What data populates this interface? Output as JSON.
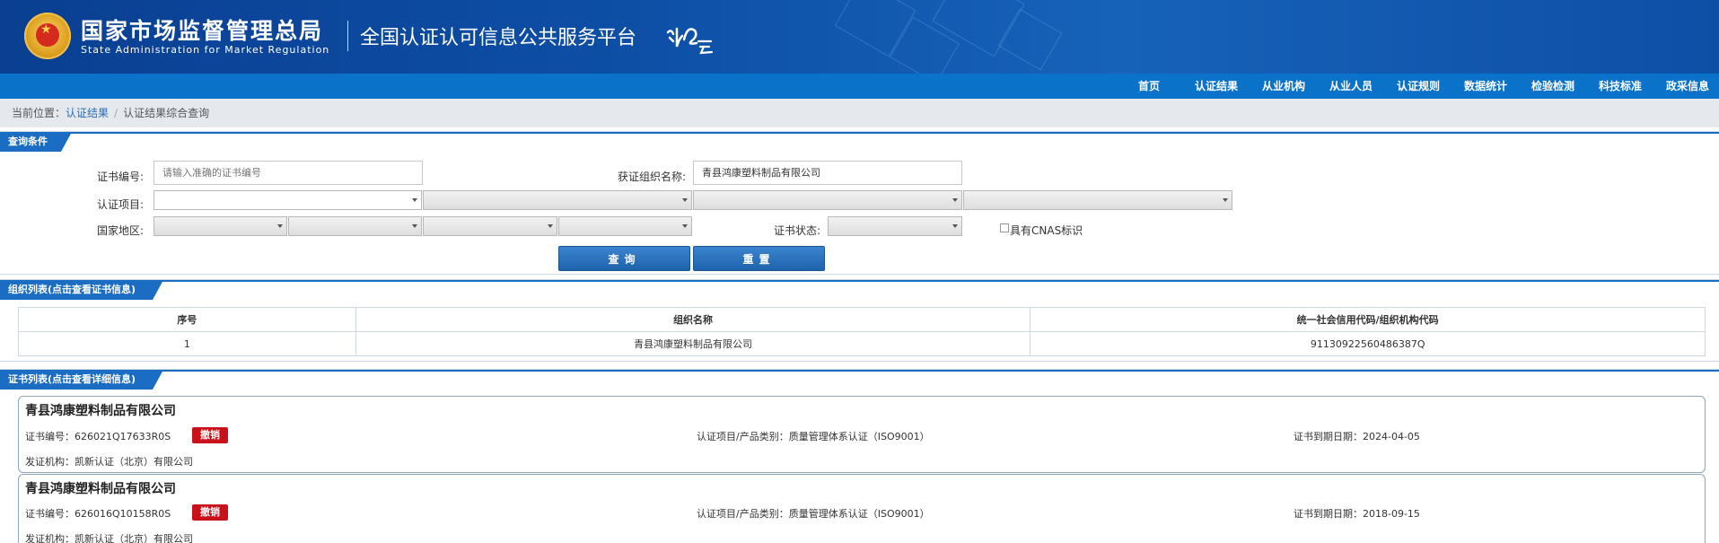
{
  "header": {
    "org_name_cn": "国家市场监督管理总局",
    "org_name_en": "State Administration  for  Market Regulation",
    "platform_title": "全国认证认可信息公共服务平台"
  },
  "nav": {
    "items": [
      "首页",
      "认证结果",
      "从业机构",
      "从业人员",
      "认证规则",
      "数据统计",
      "检验检测",
      "科技标准",
      "政采信息"
    ]
  },
  "breadcrumb": {
    "prefix": "当前位置：",
    "level1": "认证结果",
    "separator": "/",
    "level2": "认证结果综合查询"
  },
  "query": {
    "section_title": "查询条件",
    "cert_no_label": "证书编号:",
    "cert_no_placeholder": "请输入准确的证书编号",
    "org_name_label": "获证组织名称:",
    "org_name_value": "青县鸿康塑料制品有限公司",
    "cert_item_label": "认证项目:",
    "region_label": "国家地区:",
    "status_label": "证书状态:",
    "cnas_label": "具有CNAS标识",
    "search_button": "查询",
    "reset_button": "重置"
  },
  "org_list": {
    "section_title": "组织列表(点击查看证书信息)",
    "columns": [
      "序号",
      "组织名称",
      "统一社会信用代码/组织机构代码"
    ],
    "rows": [
      [
        "1",
        "青县鸿康塑料制品有限公司",
        "91130922560486387Q"
      ]
    ]
  },
  "cert_list": {
    "section_title": "证书列表(点击查看详细信息)",
    "cert_no_prefix": "证书编号：",
    "item_prefix": "认证项目/产品类别：",
    "expiry_prefix": "证书到期日期：",
    "issuer_prefix": "发证机构：",
    "certs": [
      {
        "org": "青县鸿康塑料制品有限公司",
        "cert_no": "626021Q17633R0S",
        "status": "撤销",
        "item": "质量管理体系认证（ISO9001）",
        "expiry": "2024-04-05",
        "issuer": "凯新认证（北京）有限公司"
      },
      {
        "org": "青县鸿康塑料制品有限公司",
        "cert_no": "626016Q10158R0S",
        "status": "撤销",
        "item": "质量管理体系认证（ISO9001）",
        "expiry": "2018-09-15",
        "issuer": "凯新认证（北京）有限公司"
      }
    ]
  },
  "colors": {
    "header_blue": "#0d4ea5",
    "nav_blue": "#0b72c9",
    "revoked_red": "#c9111a"
  }
}
